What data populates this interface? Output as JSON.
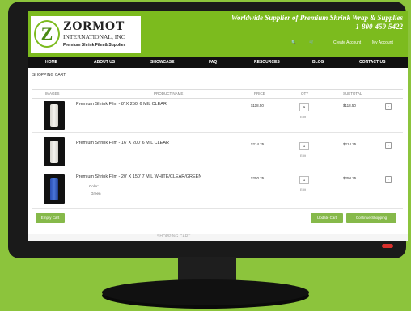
{
  "header": {
    "company_name": "ZORMOT",
    "company_sub": "INTERNATIONAL, INC",
    "logo_tag": "Premium Shrink Film & Supplies",
    "tagline": "Worldwide Supplier of Premium Shrink Wrap & Supplies",
    "phone": "1-800-459-5422",
    "search_glyph": "🔍",
    "cart_glyph": "🛒",
    "create_account": "Create Account",
    "my_account": "My Account",
    "colors": {
      "brand": "#7cbb1e",
      "nav": "#111111"
    }
  },
  "nav": {
    "items": [
      "HOME",
      "ABOUT US",
      "SHOWCASE",
      "FAQ",
      "RESOURCES",
      "BLOG",
      "CONTACT US"
    ]
  },
  "cart": {
    "title": "SHOPPING CART",
    "headers": [
      "IMAGES",
      "PRODUCT NAME",
      "PRICE",
      "QTY",
      "SUBTOTAL"
    ],
    "rows": [
      {
        "name": "Premium Shrink Film - 8' X 250' 6 MIL CLEAR",
        "price": "$118.50",
        "qty": "1",
        "edit": "Edit",
        "subtotal": "$118.50",
        "remove": "×"
      },
      {
        "name": "Premium Shrink Film - 16' X 200' 6 MIL CLEAR",
        "price": "$214.25",
        "qty": "1",
        "edit": "Edit",
        "subtotal": "$214.25",
        "remove": "×"
      },
      {
        "name": "Premium Shrink Film - 20' X 150' 7 MIL WHITE/CLEAR/GREEN",
        "option_label": "Color:",
        "option_value": "Green",
        "price": "$250.25",
        "qty": "1",
        "edit": "Edit",
        "subtotal": "$250.25",
        "remove": "×"
      }
    ],
    "buttons": {
      "empty": "Empty Cart",
      "update": "Update Cart",
      "continue": "Continue Shopping"
    }
  },
  "footer": {
    "text": "SHOPPING CART"
  }
}
